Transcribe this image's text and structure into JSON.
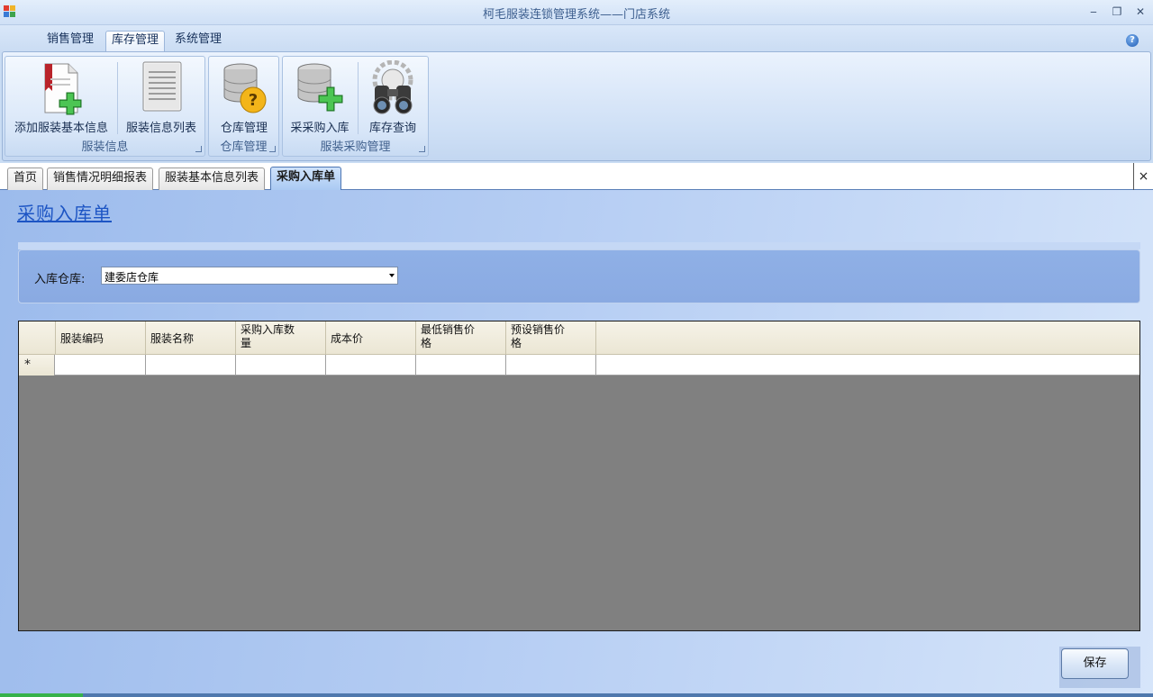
{
  "window": {
    "title": "柯毛服装连锁管理系统——门店系统",
    "minimize_glyph": "‒",
    "restore_glyph": "❐",
    "close_glyph": "✕"
  },
  "ribbon": {
    "tabs": [
      {
        "label": "销售管理",
        "active": false
      },
      {
        "label": "库存管理",
        "active": true
      },
      {
        "label": "系统管理",
        "active": false
      }
    ],
    "help_glyph": "?",
    "groups": [
      {
        "label": "服装信息",
        "buttons": [
          {
            "label": "添加服装基本信息",
            "icon": "add-document-icon"
          },
          {
            "label": "服装信息列表",
            "icon": "document-list-icon"
          }
        ]
      },
      {
        "label": "仓库管理",
        "buttons": [
          {
            "label": "仓库管理",
            "icon": "database-question-icon"
          }
        ]
      },
      {
        "label": "服装采购管理",
        "buttons": [
          {
            "label": "采采购入库",
            "icon": "database-add-icon"
          },
          {
            "label": "库存查询",
            "icon": "binoculars-icon"
          }
        ]
      }
    ]
  },
  "doc_tabs": [
    {
      "label": "首页",
      "active": false
    },
    {
      "label": "销售情况明细报表",
      "active": false
    },
    {
      "label": "服装基本信息列表",
      "active": false
    },
    {
      "label": "采购入库单",
      "active": true
    }
  ],
  "doc_close_glyph": "×",
  "form": {
    "title": "采购入库单",
    "warehouse_label": "入库仓库:",
    "warehouse_value": "建委店仓库",
    "grid": {
      "columns": [
        {
          "line1": "服装编码",
          "line2": ""
        },
        {
          "line1": "服装名称",
          "line2": ""
        },
        {
          "line1": "采购入库数",
          "line2": "量"
        },
        {
          "line1": "成本价",
          "line2": ""
        },
        {
          "line1": "最低销售价",
          "line2": "格"
        },
        {
          "line1": "预设销售价",
          "line2": "格"
        }
      ],
      "new_row_marker": "*"
    },
    "save_label": "保存"
  },
  "colors": {
    "accent": "#1d55c4",
    "ribbon_bg": "#cfe0f6",
    "grid_bg": "#808080"
  }
}
